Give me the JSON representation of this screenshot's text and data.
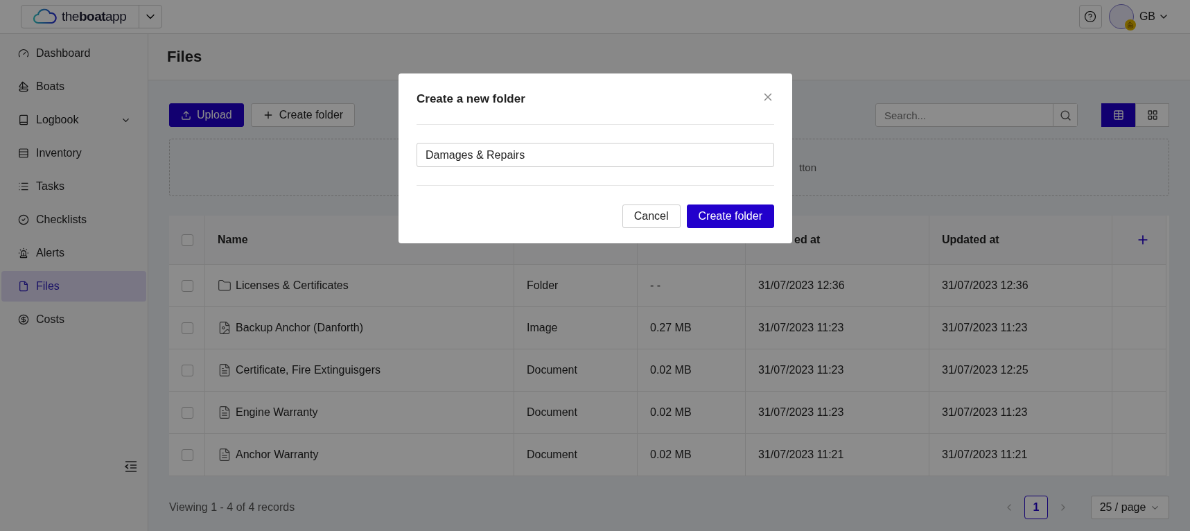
{
  "app": {
    "logo": "the**boat**app",
    "user_initials": "GB"
  },
  "sidebar": {
    "items": [
      {
        "label": "Dashboard",
        "selected": false
      },
      {
        "label": "Boats",
        "selected": false
      },
      {
        "label": "Logbook",
        "selected": false,
        "expanded": false
      },
      {
        "label": "Inventory",
        "selected": false
      },
      {
        "label": "Tasks",
        "selected": false
      },
      {
        "label": "Checklists",
        "selected": false
      },
      {
        "label": "Alerts",
        "selected": false
      },
      {
        "label": "Files",
        "selected": true
      },
      {
        "label": "Costs",
        "selected": false
      }
    ]
  },
  "page": {
    "title": "Files"
  },
  "toolbar": {
    "upload": "Upload",
    "create": "Create folder",
    "search_placeholder": "Search...",
    "views": [
      {
        "kind": "table",
        "selected": true
      },
      {
        "kind": "grid",
        "selected": false
      }
    ]
  },
  "drop_zone": {
    "text": "tton"
  },
  "table": {
    "header_checked": false,
    "columns": [
      {
        "label": "Name"
      },
      {},
      {},
      {
        "label": "ed at"
      },
      {
        "label": "Updated at"
      }
    ],
    "rows": [
      {
        "checked": false,
        "kind": "folder",
        "name": "Licenses & Certificates",
        "type": "Folder",
        "size": "- -",
        "created": "31/07/2023 12:36",
        "updated": "31/07/2023 12:36"
      },
      {
        "checked": false,
        "kind": "image",
        "name": "Backup Anchor (Danforth)",
        "type": "Image",
        "size": "0.27 MB",
        "created": "31/07/2023 11:23",
        "updated": "31/07/2023 11:23"
      },
      {
        "checked": false,
        "kind": "document",
        "name": "Certificate, Fire Extinguisgers",
        "type": "Document",
        "size": "0.02 MB",
        "created": "31/07/2023 11:23",
        "updated": "31/07/2023 12:25"
      },
      {
        "checked": false,
        "kind": "document",
        "name": "Engine Warranty",
        "type": "Document",
        "size": "0.02 MB",
        "created": "31/07/2023 11:23",
        "updated": "31/07/2023 11:23"
      },
      {
        "checked": false,
        "kind": "document",
        "name": "Anchor Warranty",
        "type": "Document",
        "size": "0.02 MB",
        "created": "31/07/2023 11:21",
        "updated": "31/07/2023 11:21"
      }
    ]
  },
  "footer": {
    "summary": "Viewing 1 - 4 of 4 records",
    "pages": [
      {
        "label": "1",
        "selected": true
      }
    ],
    "page_size": "25 / page"
  },
  "dialog": {
    "title": "Create a new folder",
    "value": "Damages & Repairs",
    "cancel": "Cancel",
    "confirm": "Create folder"
  }
}
